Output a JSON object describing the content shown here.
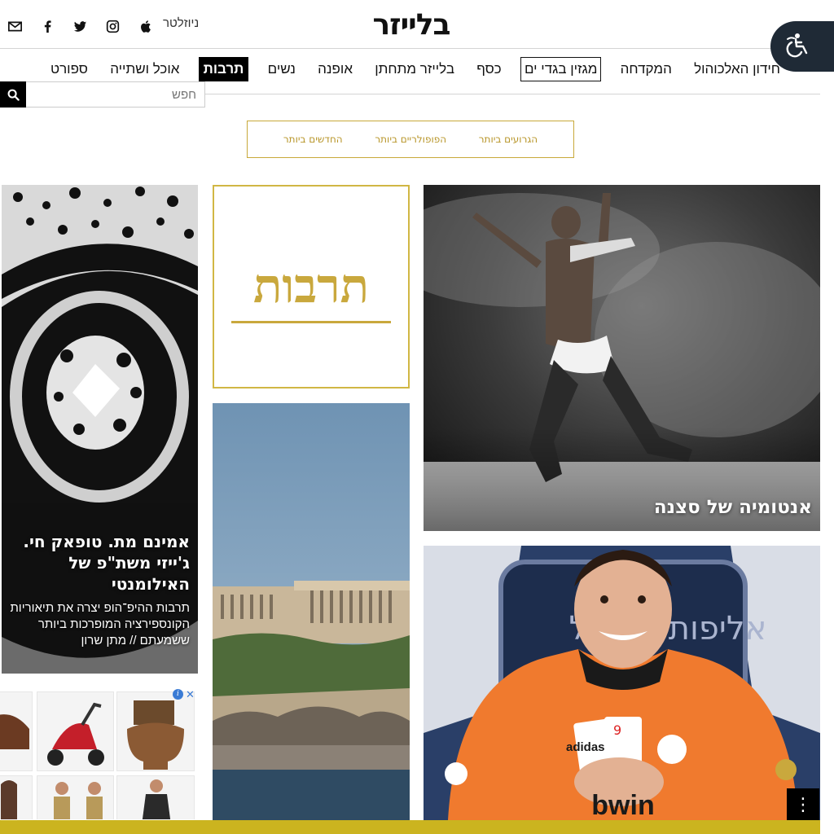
{
  "header": {
    "logo": "בלייזר",
    "newsletter_label": "ניוזלטר",
    "social_icons": [
      "mail-icon",
      "facebook-icon",
      "twitter-icon",
      "instagram-icon",
      "apple-icon"
    ]
  },
  "nav": {
    "items": [
      {
        "label": "ספורט"
      },
      {
        "label": "אוכל ושתייה"
      },
      {
        "label": "תרבות",
        "active": true
      },
      {
        "label": "נשים"
      },
      {
        "label": "אופנה"
      },
      {
        "label": "בלייזר מתחתן"
      },
      {
        "label": "כסף"
      },
      {
        "label": "מגזין בגדי ים",
        "boxed": true
      },
      {
        "label": "המקדחה"
      },
      {
        "label": "חידון האלכוהול"
      }
    ]
  },
  "search": {
    "placeholder": "חפש"
  },
  "sort_tabs": {
    "newest": "החדשים ביותר",
    "popular": "הפופולריים ביותר",
    "worst": "הגרועים ביותר"
  },
  "category": {
    "title": "תרבות"
  },
  "cards": {
    "stage": {
      "title": "אנטומיה של סצנה"
    },
    "tupac": {
      "title": "אמינם מת. טופאק חי. ג'ייזי משת\"פ של האילומנטי",
      "subtitle": "תרבות ההיפ־הופ יצרה את תיאוריות הקונספירציה המופרכות ביותר ששמעתם // מתן שרון"
    },
    "poker": {
      "shirt_brand": "adidas",
      "shirt_sponsor": "bwin",
      "card_text": "אליפות ישראל"
    }
  },
  "ad": {
    "close_label": "✕",
    "info_label": "i"
  },
  "colors": {
    "accent_gold": "#c9a83d",
    "bottom_bar": "#cbb41f",
    "accessibility_bg": "#1f2a36"
  },
  "more_button_label": "⋮"
}
